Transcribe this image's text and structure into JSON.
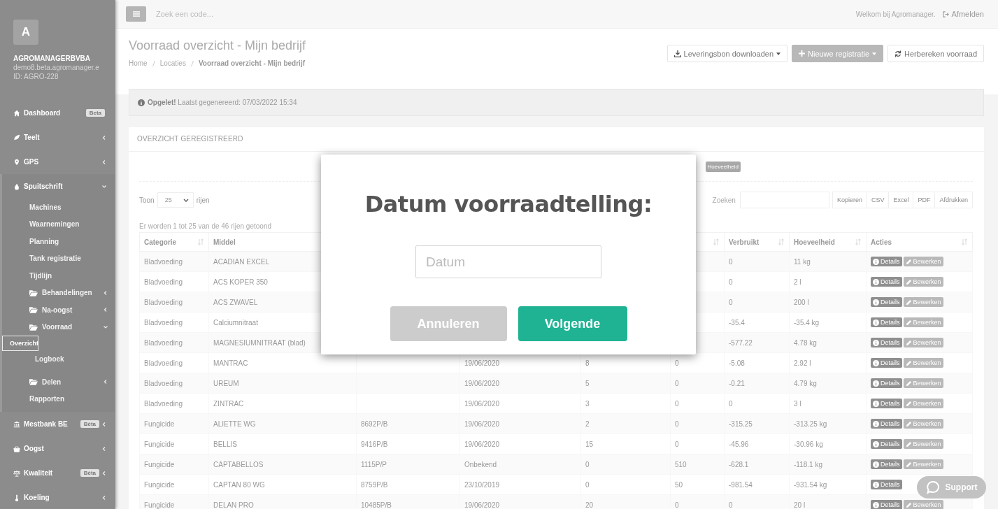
{
  "sidebar": {
    "avatar_letter": "A",
    "company": "AGROMANAGERBVBA",
    "domain": "demo8.beta.agromanager.e",
    "account_id": "ID: AGRO-228",
    "items": [
      {
        "label": "Dashboard",
        "badge": "Beta"
      },
      {
        "label": "Teelt",
        "expanded": false
      },
      {
        "label": "GPS",
        "expanded": false
      },
      {
        "label": "Spuitschrift",
        "expanded": true,
        "children": [
          {
            "label": "Machines",
            "kind": "link",
            "selected": false
          },
          {
            "label": "Waarnemingen",
            "kind": "link",
            "selected": false
          },
          {
            "label": "Planning",
            "kind": "link",
            "selected": false
          },
          {
            "label": "Tank registratie",
            "kind": "link",
            "selected": false
          },
          {
            "label": "Tijdlijn",
            "kind": "link",
            "selected": false
          },
          {
            "label": "Behandelingen",
            "kind": "folder",
            "expanded": false
          },
          {
            "label": "Na-oogst",
            "kind": "folder",
            "expanded": false
          },
          {
            "label": "Voorraad",
            "kind": "folder",
            "expanded": true,
            "children": [
              {
                "label": "Overzicht",
                "kind": "link",
                "selected": true
              },
              {
                "label": "Logboek",
                "kind": "link",
                "selected": false
              }
            ]
          },
          {
            "label": "Delen",
            "kind": "folder",
            "expanded": false
          },
          {
            "label": "Rapporten",
            "kind": "link",
            "selected": false
          }
        ]
      },
      {
        "label": "Mestbank BE",
        "badge": "Bèta",
        "expanded": false
      },
      {
        "label": "Oogst",
        "expanded": false
      },
      {
        "label": "Kwaliteit",
        "badge": "Bèta",
        "expanded": false
      },
      {
        "label": "Koeling",
        "expanded": false
      }
    ]
  },
  "topbar": {
    "search_placeholder": "Zoek een code...",
    "welcome": "Welkom bij Agromanager.",
    "logout": "Afmelden"
  },
  "page_title": "Voorraad overzicht - Mijn bedrijf",
  "breadcrumb": [
    "Home",
    "Locaties",
    "Voorraad overzicht - Mijn bedrijf"
  ],
  "header_buttons": [
    {
      "label": "Leveringsbon downloaden",
      "kind": "download"
    },
    {
      "label": "Nieuwe registratie",
      "kind": "new"
    },
    {
      "label": "Herbereken voorraad",
      "kind": "refresh"
    }
  ],
  "alert": "**Opgelet!** Laatst gegenereerd: 07/03/2022 15:34",
  "panel": {
    "title": "OVERZICHT GEREGISTREERD",
    "column_toggle": "Hoeveelheid",
    "length": {
      "before": "Toon",
      "value": "25",
      "after": "rijen"
    },
    "search_label": "Zoeken",
    "export_buttons": [
      "Kopieren",
      "CSV",
      "Excel",
      "PDF",
      "Afdrukken"
    ],
    "info": "Er worden 1 tot 25 van de 46 rijen getoond",
    "table": {
      "columns": [
        {
          "label": "Categorie",
          "sortable": true
        },
        {
          "label": "Middel"
        },
        {},
        {},
        {},
        {
          "sortable": true
        },
        {
          "label": "Verbruikt",
          "sortable": true
        },
        {
          "label": "Hoeveelheid",
          "sortable": true
        },
        {
          "label": "Acties",
          "sortable": true
        }
      ],
      "rows": [
        {
          "cells": [
            "Bladvoeding",
            "ACADIAN EXCEL",
            null,
            null,
            null,
            null,
            "0",
            "11 kg"
          ],
          "actions": [
            {
              "label": "Details",
              "kind": "details"
            },
            {
              "label": "Bewerken",
              "kind": "edit"
            }
          ]
        },
        {
          "cells": [
            "Bladvoeding",
            "ACS KOPER 350",
            null,
            null,
            null,
            null,
            "0",
            "2 l"
          ],
          "actions": [
            {
              "label": "Details",
              "kind": "details"
            },
            {
              "label": "Bewerken",
              "kind": "edit"
            }
          ]
        },
        {
          "cells": [
            "Bladvoeding",
            "ACS ZWAVEL",
            null,
            null,
            null,
            null,
            "0",
            "200 l"
          ],
          "actions": [
            {
              "label": "Details",
              "kind": "details"
            },
            {
              "label": "Bewerken",
              "kind": "edit"
            }
          ]
        },
        {
          "cells": [
            "Bladvoeding",
            "Calciumnitraat",
            null,
            null,
            null,
            null,
            "-35.4",
            "-35.4 kg"
          ],
          "actions": [
            {
              "label": "Details",
              "kind": "details"
            },
            {
              "label": "Bewerken",
              "kind": "edit"
            }
          ]
        },
        {
          "cells": [
            "Bladvoeding",
            "MAGNESIUMNITRAAT (blad)",
            null,
            null,
            null,
            null,
            "-577.22",
            "4.78 kg"
          ],
          "actions": [
            {
              "label": "Details",
              "kind": "details"
            },
            {
              "label": "Bewerken",
              "kind": "edit"
            }
          ]
        },
        {
          "cells": [
            "Bladvoeding",
            "MANTRAC",
            null,
            "19/06/2020",
            "8",
            "0",
            "-5.08",
            "2.92 l"
          ],
          "actions": [
            {
              "label": "Details",
              "kind": "details"
            },
            {
              "label": "Bewerken",
              "kind": "edit"
            }
          ]
        },
        {
          "cells": [
            "Bladvoeding",
            "UREUM",
            null,
            "19/06/2020",
            "5",
            "0",
            "-0.21",
            "4.79 kg"
          ],
          "actions": [
            {
              "label": "Details",
              "kind": "details"
            },
            {
              "label": "Bewerken",
              "kind": "edit"
            }
          ]
        },
        {
          "cells": [
            "Bladvoeding",
            "ZINTRAC",
            null,
            "19/06/2020",
            "3",
            "0",
            "0",
            "3 l"
          ],
          "actions": [
            {
              "label": "Details",
              "kind": "details"
            },
            {
              "label": "Bewerken",
              "kind": "edit"
            }
          ]
        },
        {
          "cells": [
            "Fungicide",
            "ALIETTE WG",
            "8692P/B",
            "19/06/2020",
            "2",
            "0",
            "-315.25",
            "-313.25 kg"
          ],
          "actions": [
            {
              "label": "Details",
              "kind": "details"
            },
            {
              "label": "Bewerken",
              "kind": "edit"
            }
          ]
        },
        {
          "cells": [
            "Fungicide",
            "BELLIS",
            "9416P/B",
            "19/06/2020",
            "15",
            "0",
            "-45.96",
            "-30.96 kg"
          ],
          "actions": [
            {
              "label": "Details",
              "kind": "details"
            },
            {
              "label": "Bewerken",
              "kind": "edit"
            }
          ]
        },
        {
          "cells": [
            "Fungicide",
            "CAPTABELLOS",
            "1115P/P",
            "Onbekend",
            "0",
            "510",
            "-628.1",
            "-118.1 kg"
          ],
          "actions": [
            {
              "label": "Details",
              "kind": "details"
            },
            {
              "label": "Bewerken",
              "kind": "edit"
            }
          ]
        },
        {
          "cells": [
            "Fungicide",
            "CAPTAN 80 WG",
            "8759P/B",
            "23/10/2019",
            "0",
            "50",
            "-981.54",
            "-931.54 kg"
          ],
          "actions": [
            {
              "label": "Details",
              "kind": "details"
            }
          ]
        },
        {
          "cells": [
            "Fungicide",
            "DELAN PRO",
            "10485P/B",
            "19/06/2020",
            "20",
            "0",
            "0",
            "20 l"
          ],
          "actions": [
            {
              "label": "Details",
              "kind": "details"
            },
            {
              "label": "Bewerken",
              "kind": "edit"
            }
          ]
        }
      ]
    }
  },
  "modal": {
    "title": "Datum voorraadtelling:",
    "date_placeholder": "Datum",
    "buttons": [
      {
        "label": "Annuleren",
        "kind": "cancel"
      },
      {
        "label": "Volgende",
        "kind": "primary"
      }
    ]
  },
  "support_button": "Support"
}
